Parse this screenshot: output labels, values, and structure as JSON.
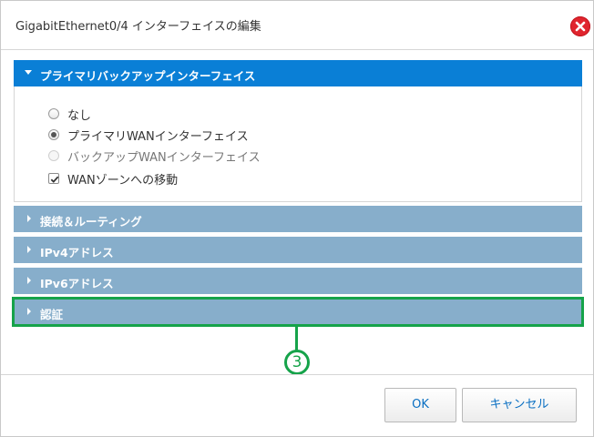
{
  "dialog": {
    "title": "GigabitEthernet0/4 インターフェイスの編集",
    "close_icon": "close-icon"
  },
  "accordion": {
    "open_panel": {
      "label": "プライマリバックアップインターフェイス",
      "options": [
        {
          "type": "radio",
          "label": "なし",
          "checked": false,
          "disabled": false
        },
        {
          "type": "radio",
          "label": "プライマリWANインターフェイス",
          "checked": true,
          "disabled": false
        },
        {
          "type": "radio",
          "label": "バックアップWANインターフェイス",
          "checked": false,
          "disabled": true
        },
        {
          "type": "checkbox",
          "label": "WANゾーンへの移動",
          "checked": true,
          "disabled": false
        }
      ]
    },
    "collapsed_panels": [
      {
        "label": "接続＆ルーティング"
      },
      {
        "label": "IPv4アドレス"
      },
      {
        "label": "IPv6アドレス"
      },
      {
        "label": "認証"
      }
    ]
  },
  "callout": {
    "number": "3",
    "color": "#16a34a"
  },
  "footer": {
    "ok_label": "OK",
    "cancel_label": "キャンセル"
  },
  "colors": {
    "accent_blue": "#0a7fd6",
    "collapsed_panel": "#87aecb",
    "close_red": "#e0252e"
  }
}
